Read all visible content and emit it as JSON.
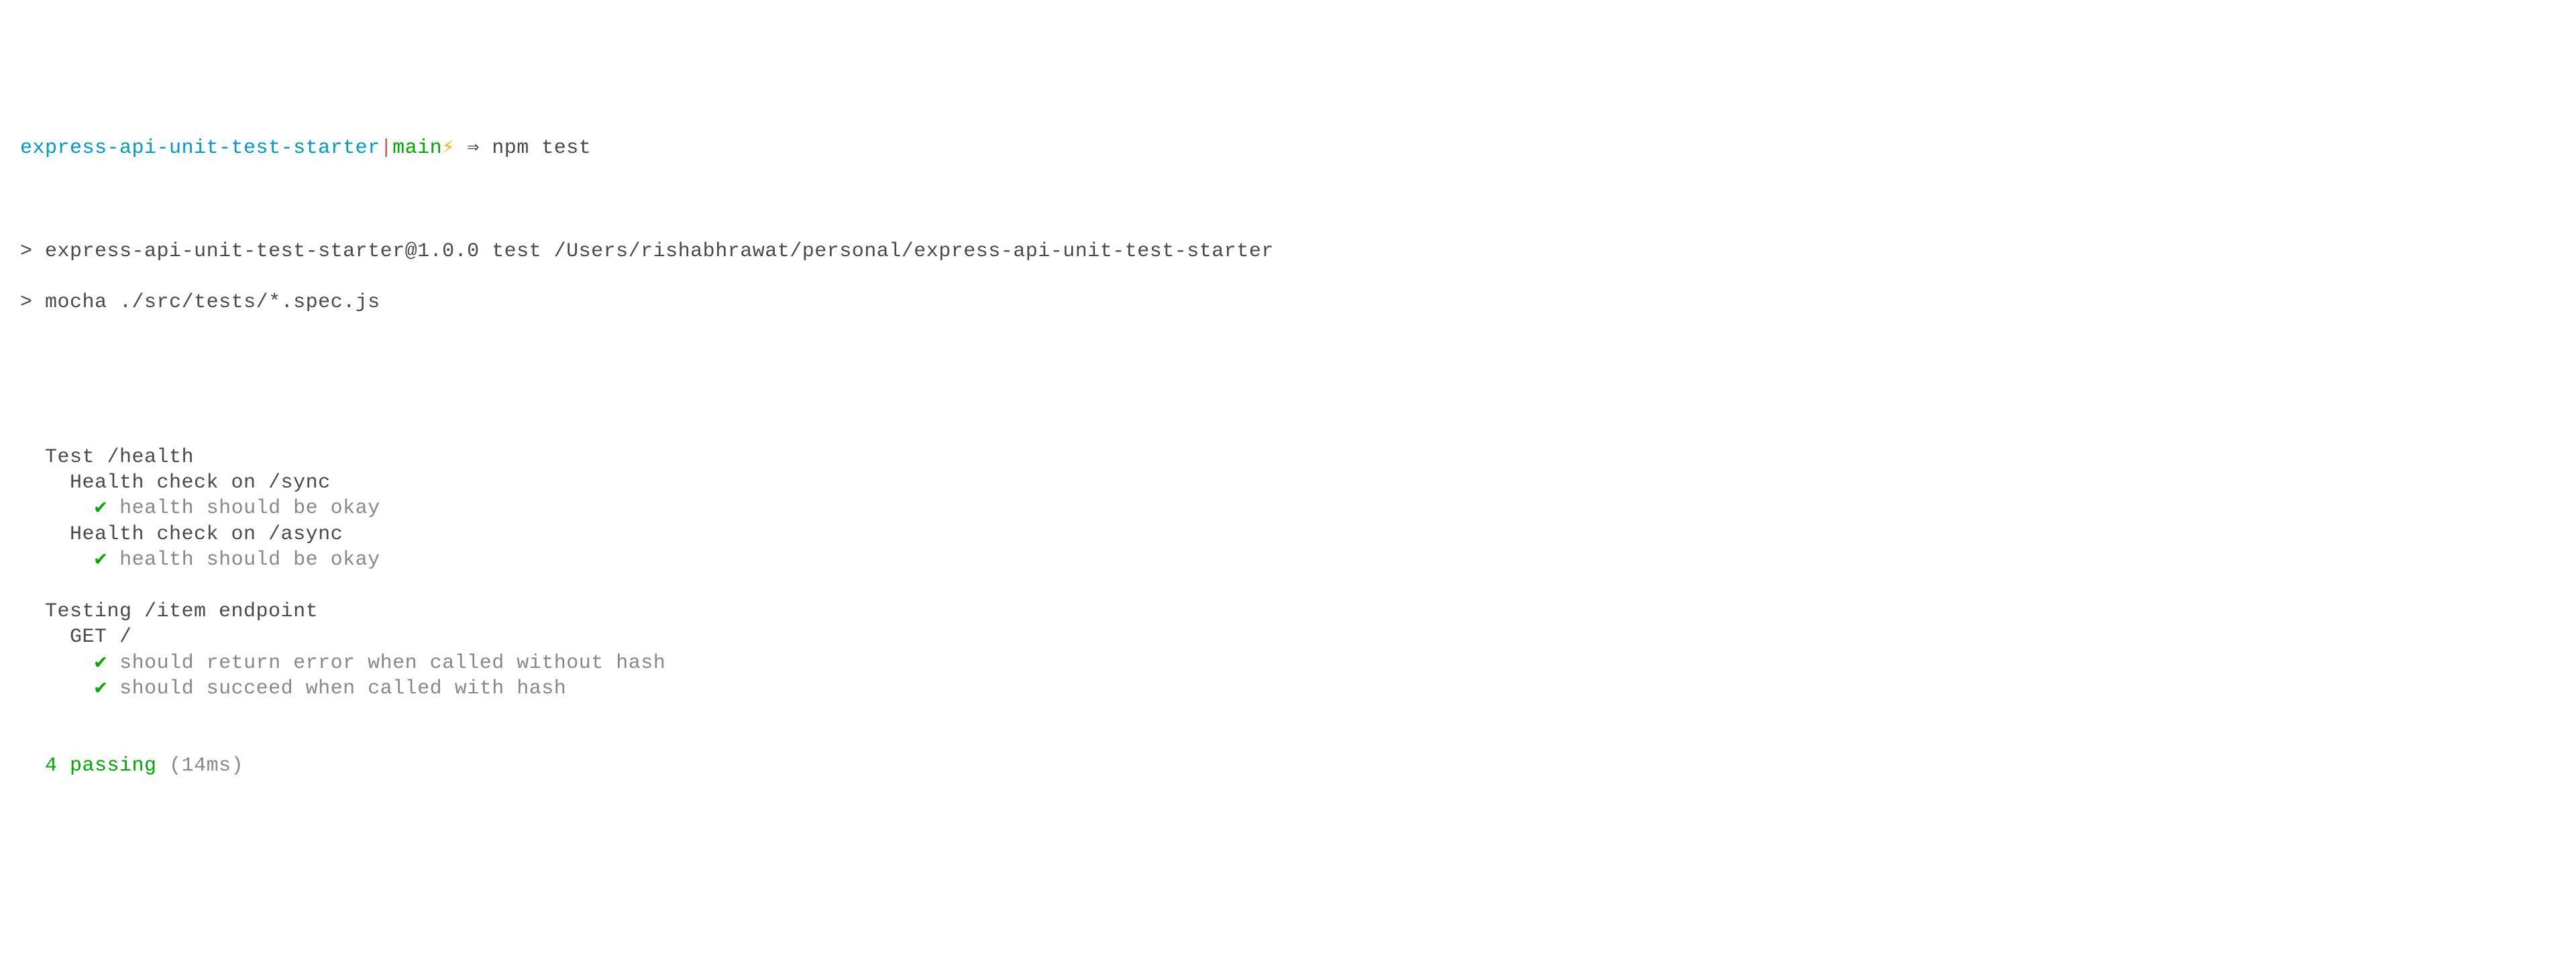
{
  "prompt": {
    "dir": "express-api-unit-test-starter",
    "separator": "|",
    "branch": "main",
    "bolt": "⚡",
    "arrow": "⇒",
    "command": "npm test"
  },
  "npm_output": {
    "line1_prefix": ">",
    "line1": "express-api-unit-test-starter@1.0.0 test /Users/rishabhrawat/personal/express-api-unit-test-starter",
    "line2_prefix": ">",
    "line2": "mocha ./src/tests/*.spec.js"
  },
  "mocha": {
    "suites": [
      {
        "title": "Test /health",
        "indent": "  ",
        "children": [
          {
            "title": "Health check on /sync",
            "indent": "    ",
            "tests": [
              {
                "indent": "      ",
                "check": "✔",
                "name": "health should be okay"
              }
            ]
          },
          {
            "title": "Health check on /async",
            "indent": "    ",
            "tests": [
              {
                "indent": "      ",
                "check": "✔",
                "name": "health should be okay"
              }
            ]
          }
        ]
      },
      {
        "title": "Testing /item endpoint",
        "indent": "  ",
        "children": [
          {
            "title": "GET /",
            "indent": "    ",
            "tests": [
              {
                "indent": "      ",
                "check": "✔",
                "name": "should return error when called without hash"
              },
              {
                "indent": "      ",
                "check": "✔",
                "name": "should succeed when called with hash"
              }
            ]
          }
        ]
      }
    ],
    "summary": {
      "indent": "  ",
      "passing_count": "4",
      "passing_label": "passing",
      "time": "(14ms)"
    }
  }
}
